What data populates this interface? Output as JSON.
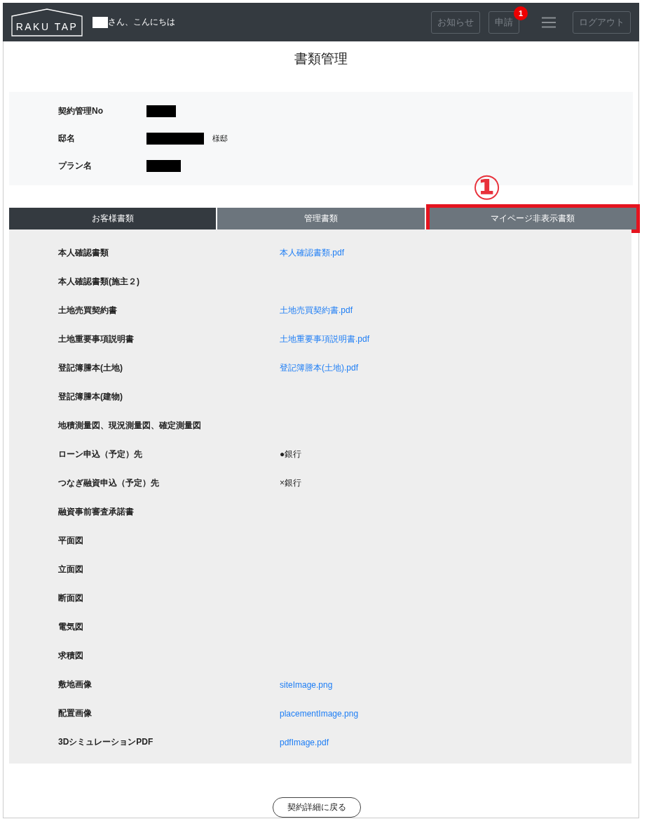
{
  "header": {
    "logo": "RAKU TAP",
    "greeting": "さん、こんにちは",
    "buttons": [
      {
        "label": "お知らせ"
      },
      {
        "label": "申請",
        "badge": "1"
      }
    ],
    "logout": "ログアウト"
  },
  "title": "書類管理",
  "info": [
    {
      "label": "契約管理No"
    },
    {
      "label": "邸名",
      "suffix": "様邸"
    },
    {
      "label": "プラン名"
    }
  ],
  "annotation": {
    "label": "①"
  },
  "tabs": [
    {
      "label": "お客様書類",
      "selected": true,
      "highlighted": false
    },
    {
      "label": "管理書類",
      "selected": false,
      "highlighted": false
    },
    {
      "label": "マイページ非表示書類",
      "selected": false,
      "highlighted": true
    }
  ],
  "documents": [
    {
      "label": "本人確認書類",
      "value": "本人確認書類.pdf",
      "kind": "link"
    },
    {
      "label": "本人確認書類(施主２)",
      "kind": "empty"
    },
    {
      "label": "土地売買契約書",
      "value": "土地売買契約書.pdf",
      "kind": "link"
    },
    {
      "label": "土地重要事項説明書",
      "value": "土地重要事項説明書.pdf",
      "kind": "link"
    },
    {
      "label": "登記簿謄本(土地)",
      "value": "登記簿謄本(土地).pdf",
      "kind": "link"
    },
    {
      "label": "登記簿謄本(建物)",
      "kind": "empty"
    },
    {
      "label": "地積測量図、現況測量図、確定測量図",
      "kind": "empty"
    },
    {
      "label": "ローン申込（予定）先",
      "value": "●銀行",
      "kind": "text"
    },
    {
      "label": "つなぎ融資申込（予定）先",
      "value": "×銀行",
      "kind": "text"
    },
    {
      "label": "融資事前審査承諾書",
      "kind": "empty"
    },
    {
      "label": "平面図",
      "kind": "empty"
    },
    {
      "label": "立面図",
      "kind": "empty"
    },
    {
      "label": "断面図",
      "kind": "empty"
    },
    {
      "label": "電気図",
      "kind": "empty"
    },
    {
      "label": "求積図",
      "kind": "empty"
    },
    {
      "label": "敷地画像",
      "value": "siteImage.png",
      "kind": "link"
    },
    {
      "label": "配置画像",
      "value": "placementImage.png",
      "kind": "link"
    },
    {
      "label": "3DシミュレーションPDF",
      "value": "pdfImage.pdf",
      "kind": "link"
    }
  ],
  "back_button": "契約詳細に戻る"
}
